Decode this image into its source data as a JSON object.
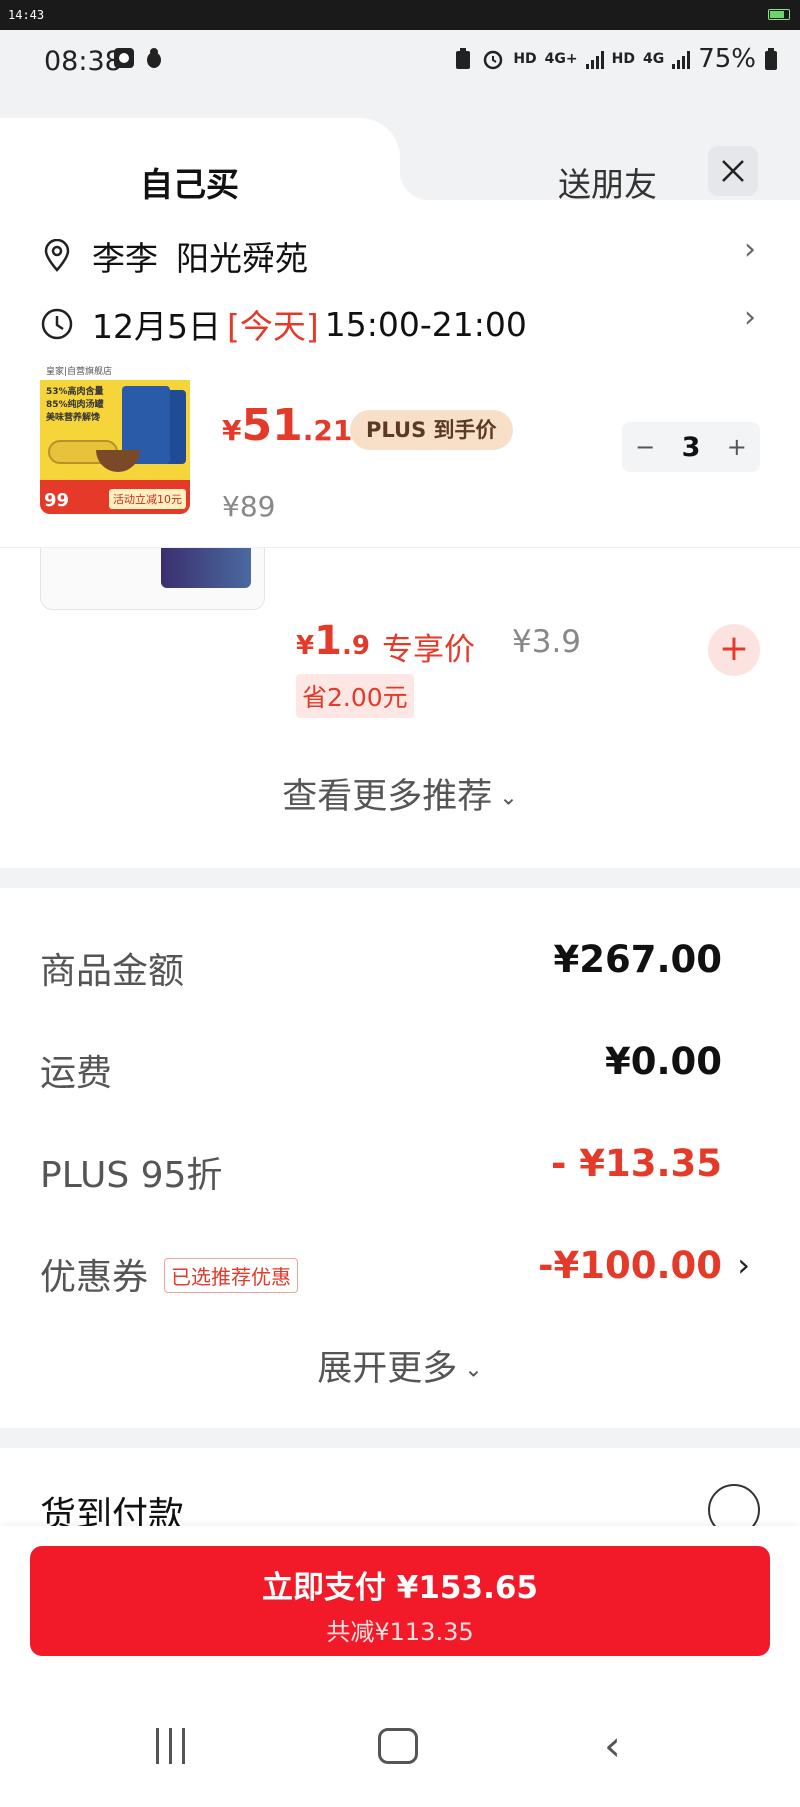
{
  "outer_bar": {
    "time": "14:43"
  },
  "status_bar": {
    "time": "08:38",
    "net1": "HD",
    "net1_gen": "4G+",
    "net2": "HD",
    "net2_gen": "4G",
    "battery": "75%"
  },
  "tabs": {
    "self": "自己买",
    "gift": "送朋友"
  },
  "address": {
    "name": "李李",
    "place": "阳光舜苑"
  },
  "delivery": {
    "date": "12月5日",
    "today": "[今天]",
    "window": "15:00-21:00"
  },
  "product": {
    "price_symbol": "¥",
    "price_int": "51",
    "price_dec": ".21",
    "plus_tag": "PLUS 到手价",
    "original_price": "¥89",
    "quantity": "3",
    "minus": "−",
    "plus": "+",
    "thumb_store": "皇家|自营旗舰店",
    "thumb_line1": "53%高肉含量",
    "thumb_line2": "85%纯肉汤罐",
    "thumb_line3": "美味营养解馋",
    "thumb_badge": "99",
    "thumb_activity": "活动立减10元"
  },
  "recommend": {
    "price_symbol": "¥",
    "price_int": "1",
    "price_dec": ".9",
    "exclusive": "专享价",
    "original_price": "¥3.9",
    "save": "省2.00元",
    "add": "+",
    "more": "查看更多推荐"
  },
  "fees": {
    "goods_label": "商品金额",
    "goods_value": "¥267.00",
    "shipping_label": "运费",
    "shipping_value": "¥0.00",
    "plus_label": "PLUS 95折",
    "plus_value": "- ¥13.35",
    "coupon_label": "优惠券",
    "coupon_tag": "已选推荐优惠",
    "coupon_value": "-¥100.00",
    "expand": "展开更多"
  },
  "cod": {
    "label": "货到付款"
  },
  "pay": {
    "main": "立即支付 ¥153.65",
    "sub": "共减¥113.35"
  },
  "colors": {
    "accent": "#e33a2a",
    "pay_button": "#f21a28"
  }
}
